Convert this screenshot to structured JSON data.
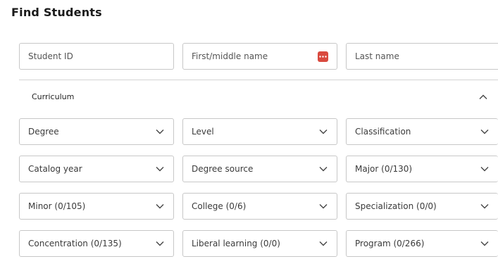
{
  "page": {
    "title": "Find Students"
  },
  "search": {
    "student_id_placeholder": "Student ID",
    "first_middle_placeholder": "First/middle name",
    "last_name_placeholder": "Last name"
  },
  "curriculum": {
    "section_label": "Curriculum",
    "dropdowns": {
      "degree": "Degree",
      "level": "Level",
      "classification": "Classification",
      "catalog_year": "Catalog year",
      "degree_source": "Degree source",
      "major": "Major (0/130)",
      "minor": "Minor (0/105)",
      "college": "College (0/6)",
      "specialization": "Specialization (0/0)",
      "concentration": "Concentration (0/135)",
      "liberal_learning": "Liberal learning (0/0)",
      "program": "Program (0/266)"
    }
  },
  "icons": {
    "chevron_down": "chevron-down-icon",
    "chevron_up": "chevron-up-icon",
    "more": "more-dots-icon"
  },
  "colors": {
    "more_badge": "#d94a3f",
    "border": "#c7c7c7"
  }
}
